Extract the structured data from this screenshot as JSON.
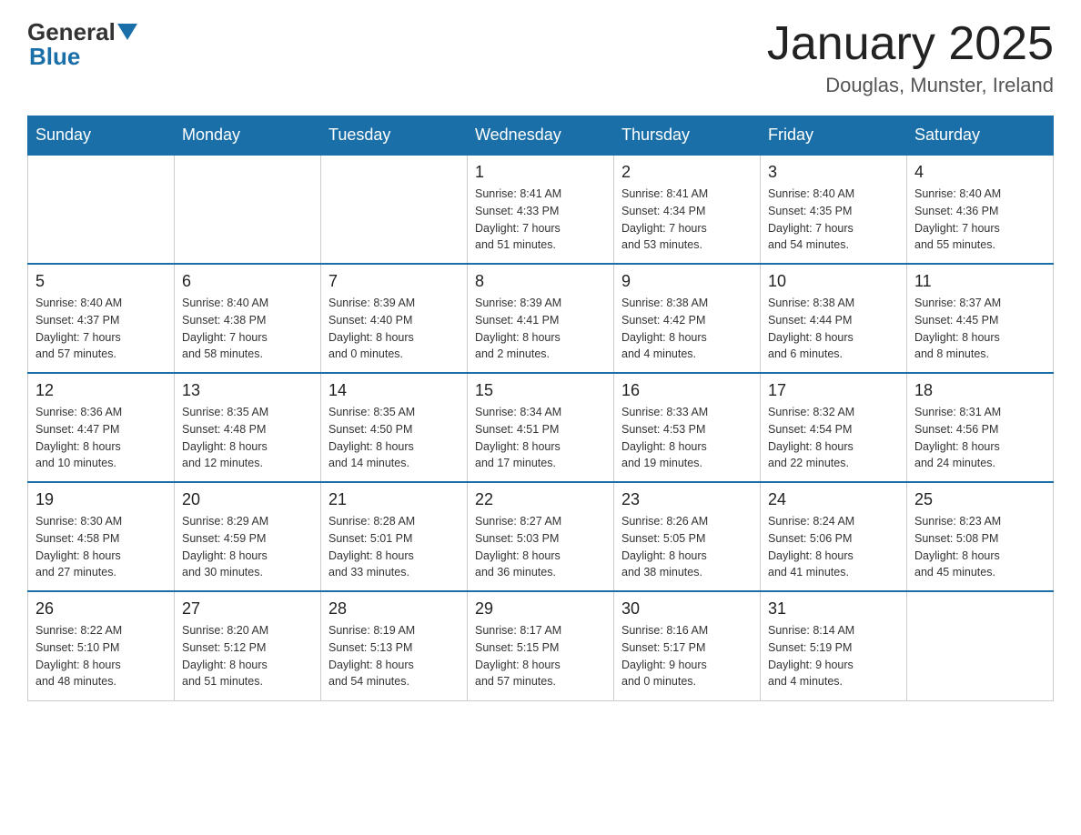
{
  "logo": {
    "general": "General",
    "blue": "Blue"
  },
  "header": {
    "title": "January 2025",
    "subtitle": "Douglas, Munster, Ireland"
  },
  "days_of_week": [
    "Sunday",
    "Monday",
    "Tuesday",
    "Wednesday",
    "Thursday",
    "Friday",
    "Saturday"
  ],
  "weeks": [
    [
      {
        "day": "",
        "info": ""
      },
      {
        "day": "",
        "info": ""
      },
      {
        "day": "",
        "info": ""
      },
      {
        "day": "1",
        "info": "Sunrise: 8:41 AM\nSunset: 4:33 PM\nDaylight: 7 hours\nand 51 minutes."
      },
      {
        "day": "2",
        "info": "Sunrise: 8:41 AM\nSunset: 4:34 PM\nDaylight: 7 hours\nand 53 minutes."
      },
      {
        "day": "3",
        "info": "Sunrise: 8:40 AM\nSunset: 4:35 PM\nDaylight: 7 hours\nand 54 minutes."
      },
      {
        "day": "4",
        "info": "Sunrise: 8:40 AM\nSunset: 4:36 PM\nDaylight: 7 hours\nand 55 minutes."
      }
    ],
    [
      {
        "day": "5",
        "info": "Sunrise: 8:40 AM\nSunset: 4:37 PM\nDaylight: 7 hours\nand 57 minutes."
      },
      {
        "day": "6",
        "info": "Sunrise: 8:40 AM\nSunset: 4:38 PM\nDaylight: 7 hours\nand 58 minutes."
      },
      {
        "day": "7",
        "info": "Sunrise: 8:39 AM\nSunset: 4:40 PM\nDaylight: 8 hours\nand 0 minutes."
      },
      {
        "day": "8",
        "info": "Sunrise: 8:39 AM\nSunset: 4:41 PM\nDaylight: 8 hours\nand 2 minutes."
      },
      {
        "day": "9",
        "info": "Sunrise: 8:38 AM\nSunset: 4:42 PM\nDaylight: 8 hours\nand 4 minutes."
      },
      {
        "day": "10",
        "info": "Sunrise: 8:38 AM\nSunset: 4:44 PM\nDaylight: 8 hours\nand 6 minutes."
      },
      {
        "day": "11",
        "info": "Sunrise: 8:37 AM\nSunset: 4:45 PM\nDaylight: 8 hours\nand 8 minutes."
      }
    ],
    [
      {
        "day": "12",
        "info": "Sunrise: 8:36 AM\nSunset: 4:47 PM\nDaylight: 8 hours\nand 10 minutes."
      },
      {
        "day": "13",
        "info": "Sunrise: 8:35 AM\nSunset: 4:48 PM\nDaylight: 8 hours\nand 12 minutes."
      },
      {
        "day": "14",
        "info": "Sunrise: 8:35 AM\nSunset: 4:50 PM\nDaylight: 8 hours\nand 14 minutes."
      },
      {
        "day": "15",
        "info": "Sunrise: 8:34 AM\nSunset: 4:51 PM\nDaylight: 8 hours\nand 17 minutes."
      },
      {
        "day": "16",
        "info": "Sunrise: 8:33 AM\nSunset: 4:53 PM\nDaylight: 8 hours\nand 19 minutes."
      },
      {
        "day": "17",
        "info": "Sunrise: 8:32 AM\nSunset: 4:54 PM\nDaylight: 8 hours\nand 22 minutes."
      },
      {
        "day": "18",
        "info": "Sunrise: 8:31 AM\nSunset: 4:56 PM\nDaylight: 8 hours\nand 24 minutes."
      }
    ],
    [
      {
        "day": "19",
        "info": "Sunrise: 8:30 AM\nSunset: 4:58 PM\nDaylight: 8 hours\nand 27 minutes."
      },
      {
        "day": "20",
        "info": "Sunrise: 8:29 AM\nSunset: 4:59 PM\nDaylight: 8 hours\nand 30 minutes."
      },
      {
        "day": "21",
        "info": "Sunrise: 8:28 AM\nSunset: 5:01 PM\nDaylight: 8 hours\nand 33 minutes."
      },
      {
        "day": "22",
        "info": "Sunrise: 8:27 AM\nSunset: 5:03 PM\nDaylight: 8 hours\nand 36 minutes."
      },
      {
        "day": "23",
        "info": "Sunrise: 8:26 AM\nSunset: 5:05 PM\nDaylight: 8 hours\nand 38 minutes."
      },
      {
        "day": "24",
        "info": "Sunrise: 8:24 AM\nSunset: 5:06 PM\nDaylight: 8 hours\nand 41 minutes."
      },
      {
        "day": "25",
        "info": "Sunrise: 8:23 AM\nSunset: 5:08 PM\nDaylight: 8 hours\nand 45 minutes."
      }
    ],
    [
      {
        "day": "26",
        "info": "Sunrise: 8:22 AM\nSunset: 5:10 PM\nDaylight: 8 hours\nand 48 minutes."
      },
      {
        "day": "27",
        "info": "Sunrise: 8:20 AM\nSunset: 5:12 PM\nDaylight: 8 hours\nand 51 minutes."
      },
      {
        "day": "28",
        "info": "Sunrise: 8:19 AM\nSunset: 5:13 PM\nDaylight: 8 hours\nand 54 minutes."
      },
      {
        "day": "29",
        "info": "Sunrise: 8:17 AM\nSunset: 5:15 PM\nDaylight: 8 hours\nand 57 minutes."
      },
      {
        "day": "30",
        "info": "Sunrise: 8:16 AM\nSunset: 5:17 PM\nDaylight: 9 hours\nand 0 minutes."
      },
      {
        "day": "31",
        "info": "Sunrise: 8:14 AM\nSunset: 5:19 PM\nDaylight: 9 hours\nand 4 minutes."
      },
      {
        "day": "",
        "info": ""
      }
    ]
  ]
}
